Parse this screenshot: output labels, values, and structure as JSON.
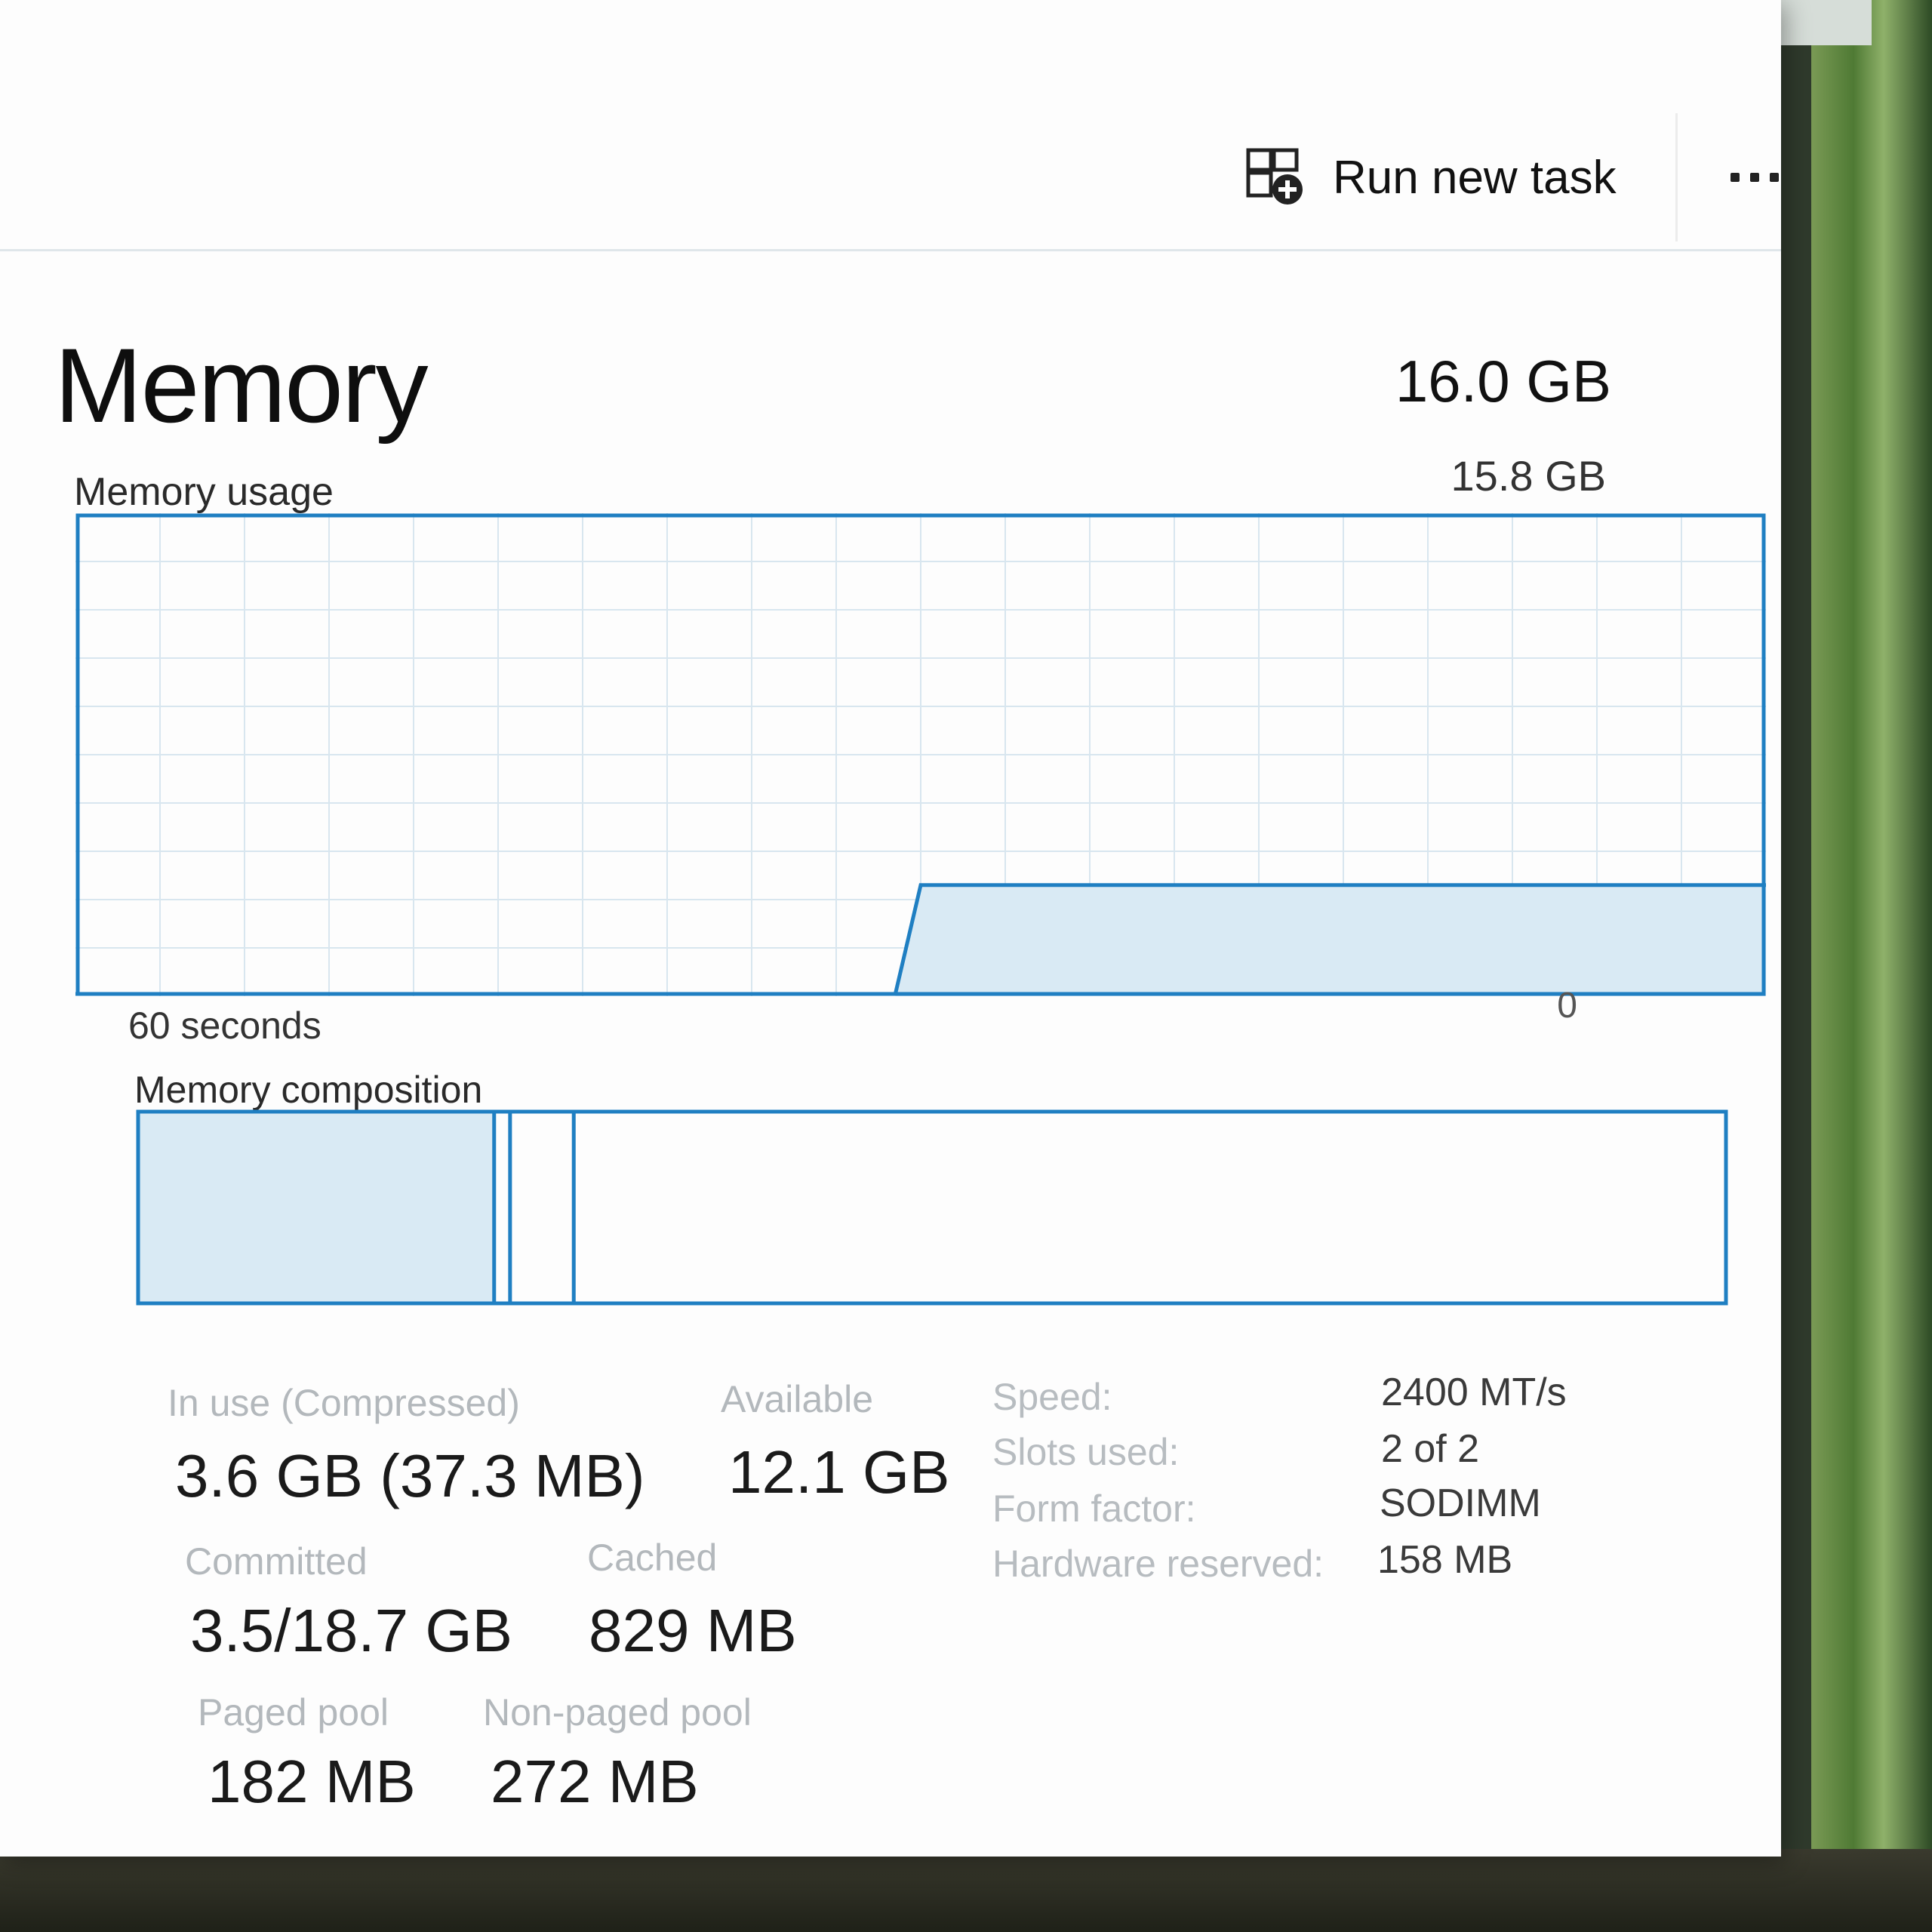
{
  "toolbar": {
    "run_new_task_label": "Run new task",
    "run_new_task_icon": "run-task-icon",
    "more_icon": "more-options-icon"
  },
  "memory": {
    "title": "Memory",
    "total": "16.0 GB",
    "usage_label": "Memory usage",
    "usage_max": "15.8 GB",
    "axis_left": "60 seconds",
    "axis_right": "0",
    "composition_label": "Memory composition",
    "usage_fraction_current": 0.23,
    "composition": {
      "in_use_fraction": 0.225,
      "modified_fraction": 0.01,
      "standby_fraction": 0.04,
      "free_fraction": 0.725
    }
  },
  "stats": {
    "in_use_label": "In use (Compressed)",
    "in_use_value": "3.6 GB (37.3 MB)",
    "available_label": "Available",
    "available_value": "12.1 GB",
    "committed_label": "Committed",
    "committed_value": "3.5/18.7 GB",
    "cached_label": "Cached",
    "cached_value": "829 MB",
    "paged_pool_label": "Paged pool",
    "paged_pool_value": "182 MB",
    "non_paged_pool_label": "Non-paged pool",
    "non_paged_pool_value": "272 MB"
  },
  "specs": {
    "speed_label": "Speed:",
    "speed_value": "2400 MT/s",
    "slots_label": "Slots used:",
    "slots_value": "2 of 2",
    "form_factor_label": "Form factor:",
    "form_factor_value": "SODIMM",
    "hardware_reserved_label": "Hardware reserved:",
    "hardware_reserved_value": "158 MB"
  },
  "colors": {
    "accent": "#1f7fc2",
    "fill": "#d9eaf4",
    "grid": "#d8e6ef"
  }
}
